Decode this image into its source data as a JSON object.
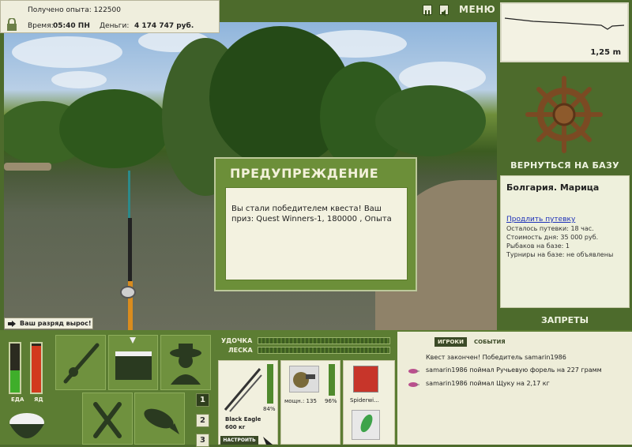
{
  "stats": {
    "experience_label": "Получено опыта:",
    "experience_value": "122500",
    "time_label": "Время:",
    "time_value": "05:40 ПН",
    "money_label": "Деньги:",
    "money_value": "4 174 747 руб."
  },
  "toolbar": {
    "menu_label": "МЕНЮ",
    "pause_icon": "pause-icon",
    "sound_icon": "sound-icon"
  },
  "depth": {
    "value": "1,25 m"
  },
  "base": {
    "return_label": "ВЕРНУТЬСЯ НА БАЗУ",
    "place": "Болгария. Марица",
    "extend_link": "Продлить путевку",
    "lines": [
      "Осталось путевки: 18 час.",
      "Стоимость дня: 35 000 руб.",
      "Рыбаков на базе: 1",
      "Турниры на базе: не объявлены"
    ],
    "bans_label": "ЗАПРЕТЫ"
  },
  "dialog": {
    "title": "ПРЕДУПРЕЖДЕНИЕ",
    "message": "Вы стали победителем квеста! Ваш приз: Quest Winners-1, 180000 , Опыта"
  },
  "rank_banner": "Ваш разряд вырос!",
  "gauges": {
    "food_label": "ЕДА",
    "poison_label": "ЯД",
    "food_level": 0.45,
    "poison_level": 0.95
  },
  "tackle": {
    "rod_label": "УДОЧКА",
    "line_label": "ЛЕСКА",
    "rod_name": "Black Eagle",
    "rod_size": "600 кг",
    "rod_percent": "84%",
    "reel_power": "мощн.: 135",
    "reel_percent": "96%",
    "line_name": "Spiderwi...",
    "adjust_button": "НАСТРОИТЬ"
  },
  "pages": [
    "1",
    "2",
    "3"
  ],
  "events": {
    "tab_players": "ИГРОКИ",
    "tab_events": "СОБЫТИЯ",
    "items": [
      "Квест закончен! Победитель samarin1986",
      "samarin1986 поймал Ручьевую форель на 227 грамм",
      "samarin1986 поймал Щуку на 2,17 кг"
    ]
  },
  "colors": {
    "panel_green": "#5c7d33",
    "dialog_green": "#6c8f39",
    "cream": "#eeedd9",
    "link_blue": "#1c2fb8"
  }
}
